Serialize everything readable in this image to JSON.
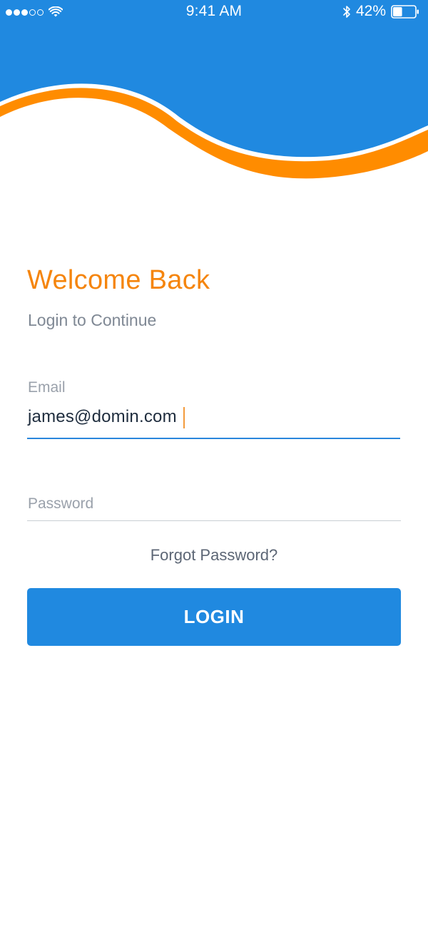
{
  "status_bar": {
    "time": "9:41 AM",
    "battery_percent": "42%",
    "battery_level": 0.42,
    "signal_bars_filled": 3,
    "signal_bars_total": 5
  },
  "header": {
    "primary_color": "#2089e0",
    "accent_color": "#ff8c00"
  },
  "login": {
    "title": "Welcome Back",
    "subtitle": "Login to Continue",
    "email_label": "Email",
    "email_value": "james@domin.com",
    "password_placeholder": "Password",
    "forgot_password": "Forgot Password?",
    "login_button": "LOGIN"
  },
  "icons": {
    "signal": "signal-dots-icon",
    "wifi": "wifi-icon",
    "bluetooth": "bluetooth-icon",
    "battery": "battery-icon"
  }
}
